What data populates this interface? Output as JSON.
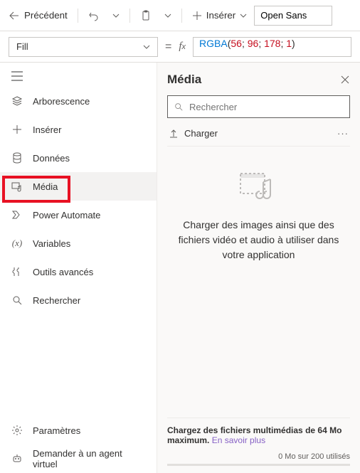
{
  "toolbar": {
    "back_label": "Précédent",
    "insert_label": "Insérer",
    "font_value": "Open Sans"
  },
  "formula": {
    "property": "Fill",
    "value_fn": "RGBA",
    "value_args": "56;  96;  178;  1"
  },
  "sidebar": {
    "items": [
      {
        "label": "Arborescence"
      },
      {
        "label": "Insérer"
      },
      {
        "label": "Données"
      },
      {
        "label": "Média"
      },
      {
        "label": "Power Automate"
      },
      {
        "label": "Variables"
      },
      {
        "label": "Outils avancés"
      },
      {
        "label": "Rechercher"
      }
    ],
    "settings_label": "Paramètres",
    "agent_label": "Demander à un agent virtuel"
  },
  "panel": {
    "title": "Média",
    "search_placeholder": "Rechercher",
    "upload_label": "Charger",
    "empty_text": "Charger des images ainsi que des fichiers vidéo et audio à utiliser dans votre application",
    "footer_text_1": "Chargez des fichiers multimédias de 64 Mo maximum. ",
    "footer_link": "En savoir plus",
    "usage_text": "0 Mo sur 200 utilisés"
  }
}
